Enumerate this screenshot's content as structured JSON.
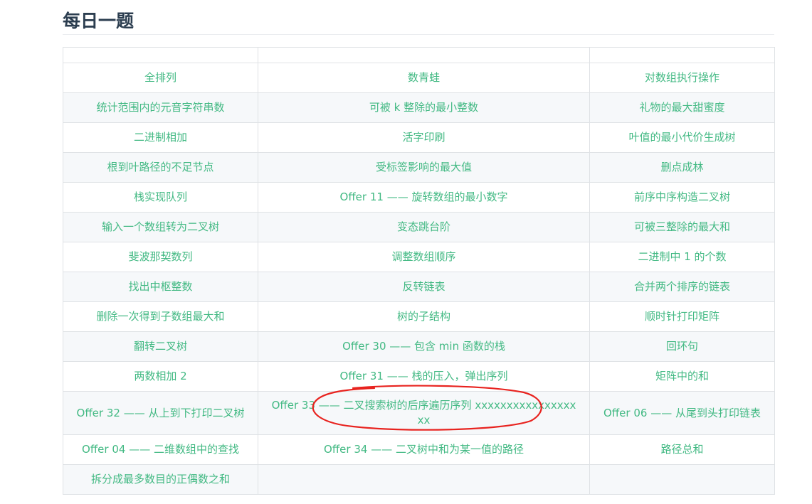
{
  "page": {
    "title": "每日一题"
  },
  "table": {
    "rows": [
      [
        "全排列",
        "数青蛙",
        "对数组执行操作"
      ],
      [
        "统计范围内的元音字符串数",
        "可被 k 整除的最小整数",
        "礼物的最大甜蜜度"
      ],
      [
        "二进制相加",
        "活字印刷",
        "叶值的最小代价生成树"
      ],
      [
        "根到叶路径的不足节点",
        "受标签影响的最大值",
        "删点成林"
      ],
      [
        "栈实现队列",
        "Offer 11 —— 旋转数组的最小数字",
        "前序中序构造二叉树"
      ],
      [
        "输入一个数组转为二叉树",
        "变态跳台阶",
        "可被三整除的最大和"
      ],
      [
        "斐波那契数列",
        "调整数组顺序",
        "二进制中 1 的个数"
      ],
      [
        "找出中枢整数",
        "反转链表",
        "合并两个排序的链表"
      ],
      [
        "删除一次得到子数组最大和",
        "树的子结构",
        "顺时针打印矩阵"
      ],
      [
        "翻转二叉树",
        "Offer 30 —— 包含 min 函数的栈",
        "回环句"
      ],
      [
        "两数相加 2",
        "Offer 31 —— 栈的压入，弹出序列",
        "矩阵中的和"
      ],
      [
        "Offer 32 —— 从上到下打印二叉树",
        "Offer 33 —— 二叉搜索树的后序遍历序列 xxxxxxxxxxxxxxxxxx",
        "Offer 06 —— 从尾到头打印链表"
      ],
      [
        "Offer 04 —— 二维数组中的查找",
        "Offer 34 —— 二叉树中和为某一值的路径",
        "路径总和"
      ],
      [
        "拆分成最多数目的正偶数之和",
        "",
        ""
      ]
    ]
  },
  "colors": {
    "link": "#42b983",
    "heading": "#2c3e50",
    "border": "#dfe2e5",
    "stripe": "#f6f8fa",
    "annotation": "#e8231f"
  }
}
